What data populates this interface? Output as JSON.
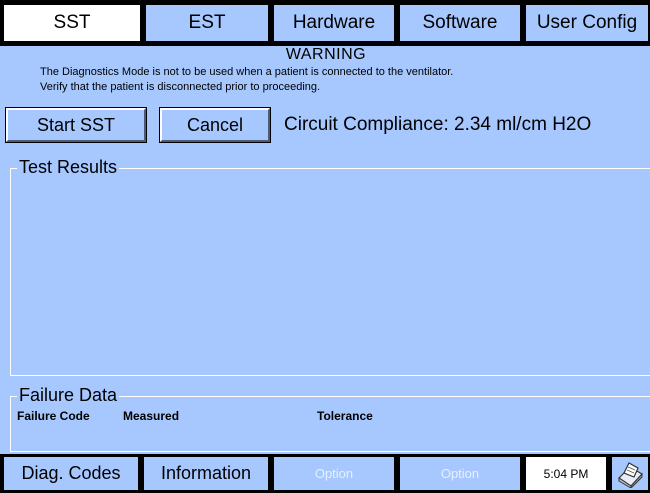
{
  "tabs": [
    {
      "label": "SST",
      "active": true
    },
    {
      "label": "EST",
      "active": false
    },
    {
      "label": "Hardware",
      "active": false
    },
    {
      "label": "Software",
      "active": false
    },
    {
      "label": "User Config",
      "active": false
    }
  ],
  "warning": {
    "title": "WARNING",
    "line1": "The Diagnostics Mode is not to be used when a patient is connected to the ventilator.",
    "line2": "Verify that the patient is disconnected prior to proceeding."
  },
  "actions": {
    "start_label": "Start SST",
    "cancel_label": "Cancel"
  },
  "compliance": {
    "text": "Circuit Compliance: 2.34 ml/cm H2O"
  },
  "results": {
    "title": "Test Results"
  },
  "failure": {
    "title": "Failure Data",
    "columns": [
      "Failure Code",
      "Measured",
      "Tolerance"
    ]
  },
  "bottom": {
    "diag_label": "Diag. Codes",
    "info_label": "Information",
    "option1_label": "Option",
    "option2_label": "Option",
    "time": "5:04 PM",
    "printer_icon": "printer-icon"
  },
  "colors": {
    "panel_bg": "#a6c8ff",
    "active_tab_bg": "#ffffff",
    "border": "#000000"
  }
}
